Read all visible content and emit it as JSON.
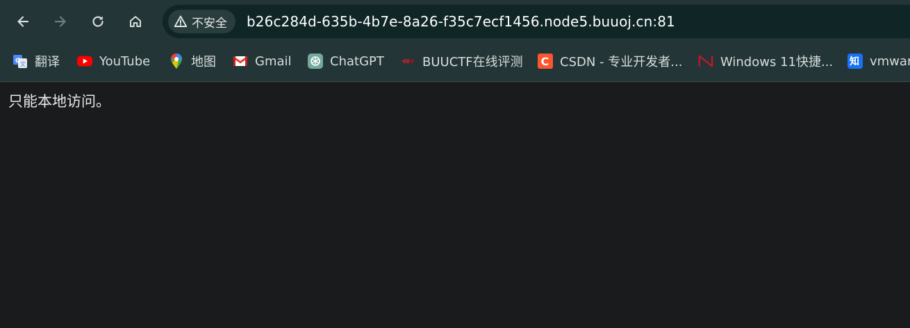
{
  "toolbar": {
    "back_icon": "arrow-left-icon",
    "forward_icon": "arrow-right-icon",
    "reload_icon": "reload-icon",
    "home_icon": "home-icon"
  },
  "omnibox": {
    "security_icon": "warning-triangle-icon",
    "security_label": "不安全",
    "url": "b26c284d-635b-4b7e-8a26-f35c7ecf1456.node5.buuoj.cn:81"
  },
  "bookmarks": [
    {
      "label": "翻译",
      "icon": "google-translate-icon"
    },
    {
      "label": "YouTube",
      "icon": "youtube-icon"
    },
    {
      "label": "地图",
      "icon": "google-maps-icon"
    },
    {
      "label": "Gmail",
      "icon": "gmail-icon"
    },
    {
      "label": "ChatGPT",
      "icon": "chatgpt-icon"
    },
    {
      "label": "BUUCTF在线评测",
      "icon": "buuctf-icon"
    },
    {
      "label": "CSDN - 专业开发者...",
      "icon": "csdn-icon"
    },
    {
      "label": "Windows 11快捷...",
      "icon": "n-logo-icon"
    },
    {
      "label": "vmware",
      "icon": "zhihu-icon"
    }
  ],
  "page": {
    "message": "只能本地访问。"
  },
  "colors": {
    "chrome_bg": "#233536",
    "omnibox_bg": "#0f2526",
    "page_bg": "#1a1b1c",
    "youtube_red": "#ff0000",
    "csdn_red": "#fc5531",
    "zhihu_blue": "#1772f6"
  }
}
